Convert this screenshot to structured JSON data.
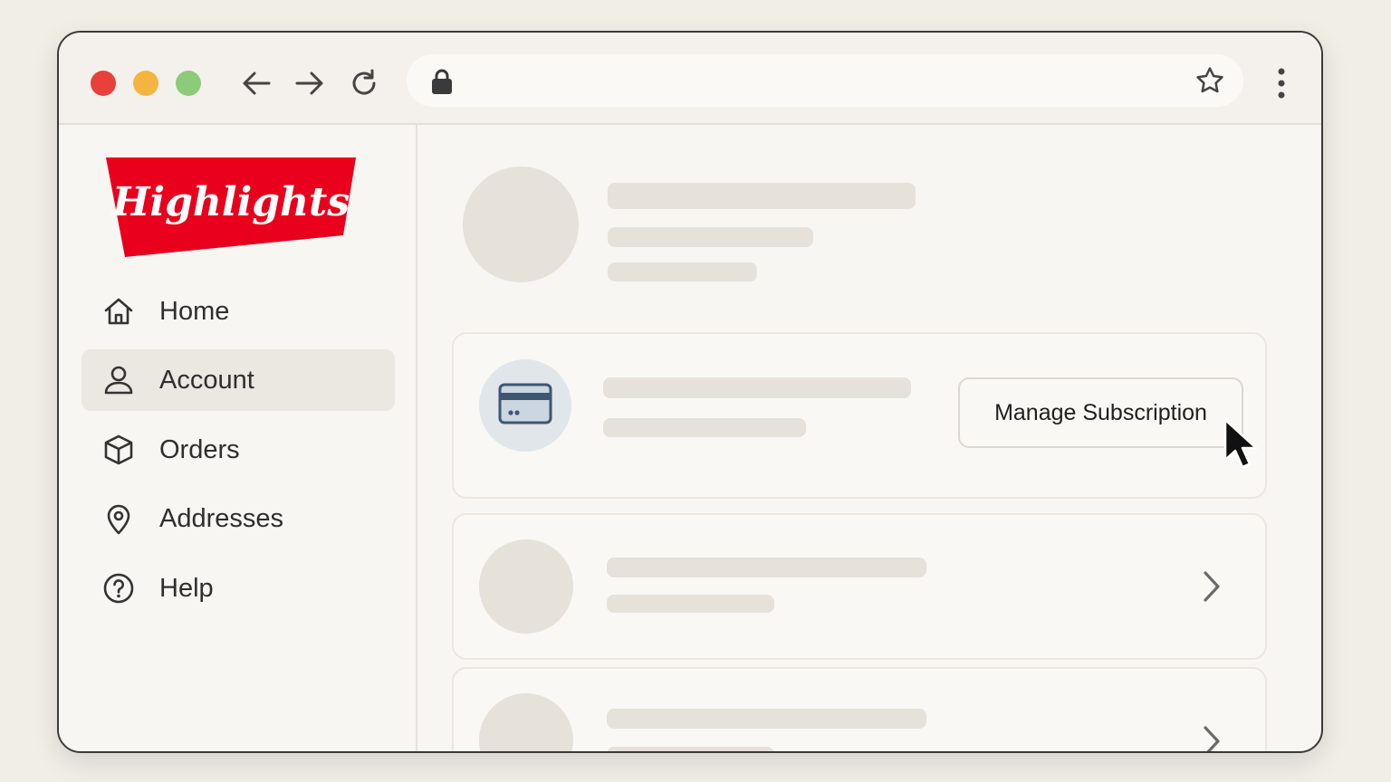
{
  "browser": {
    "icons": [
      "close-light",
      "minimize-light",
      "maximize-light",
      "back-arrow-icon",
      "forward-arrow-icon",
      "reload-icon",
      "lock-icon",
      "star-icon",
      "more-vertical-icon"
    ]
  },
  "brand": {
    "logo_text": "Highlights",
    "logo_color": "#e8001c"
  },
  "sidebar": {
    "items": [
      {
        "label": "Home",
        "icon": "home-icon",
        "active": false
      },
      {
        "label": "Account",
        "icon": "user-icon",
        "active": true
      },
      {
        "label": "Orders",
        "icon": "box-icon",
        "active": false
      },
      {
        "label": "Addresses",
        "icon": "map-pin-icon",
        "active": false
      },
      {
        "label": "Help",
        "icon": "help-circle-icon",
        "active": false
      }
    ]
  },
  "main": {
    "subscription_card": {
      "icon": "credit-card-icon",
      "button_label": "Manage Subscription"
    }
  }
}
